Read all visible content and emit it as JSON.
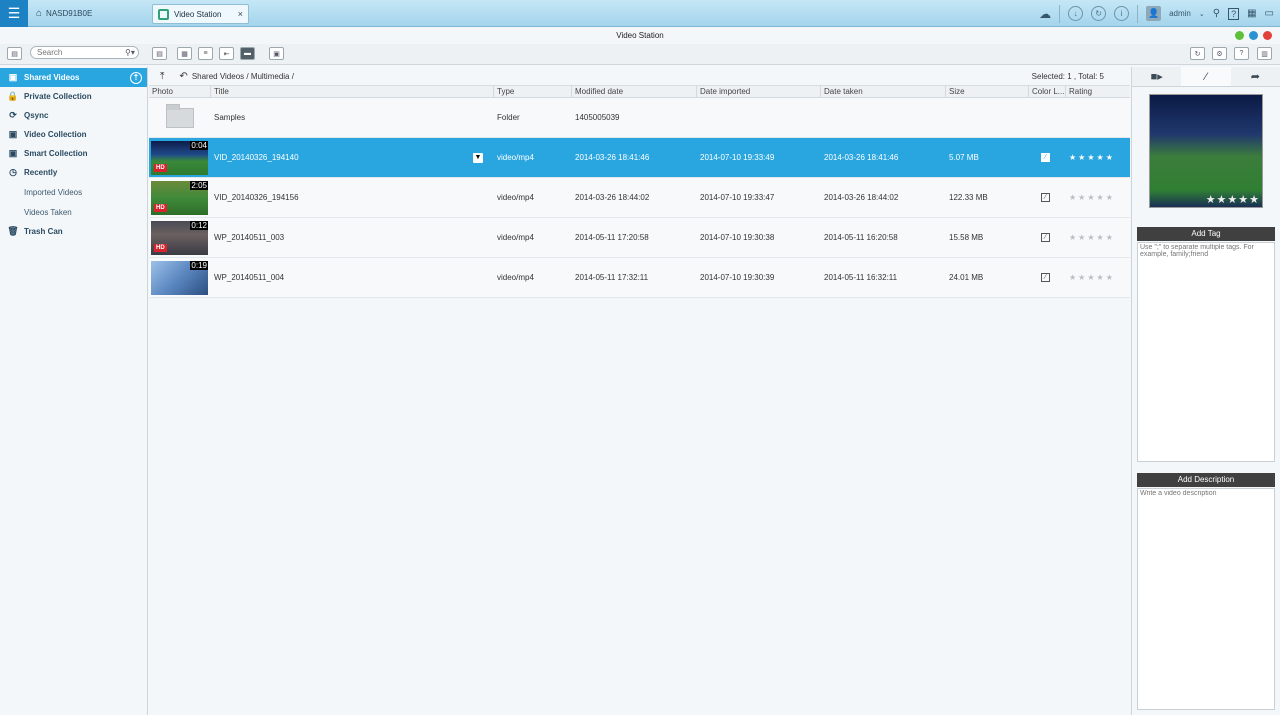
{
  "topbar": {
    "nas_name": "NASD91B0E",
    "tab_label": "Video Station",
    "tab_close": "×",
    "user": "admin"
  },
  "window": {
    "title": "Video Station"
  },
  "search": {
    "placeholder": "Search"
  },
  "sidebar": {
    "items": [
      {
        "label": "Shared Videos",
        "icon": "shared-videos-icon"
      },
      {
        "label": "Private Collection",
        "icon": "lock-icon"
      },
      {
        "label": "Qsync",
        "icon": "qsync-icon"
      },
      {
        "label": "Video Collection",
        "icon": "collection-icon"
      },
      {
        "label": "Smart Collection",
        "icon": "smart-collection-icon"
      },
      {
        "label": "Recently",
        "icon": "clock-icon"
      },
      {
        "label": "Imported Videos"
      },
      {
        "label": "Videos Taken"
      },
      {
        "label": "Trash Can",
        "icon": "trash-icon"
      }
    ]
  },
  "main": {
    "breadcrumb": "Shared Videos / Multimedia /",
    "count": "Selected: 1 , Total: 5",
    "columns": [
      "Photo",
      "Title",
      "Type",
      "Modified date",
      "Date imported",
      "Date taken",
      "Size",
      "Color L...",
      "Rating"
    ],
    "rows": [
      {
        "title": "Samples",
        "type": "Folder",
        "modified": "1405005039",
        "imported": "",
        "taken": "",
        "size": "",
        "duration": ""
      },
      {
        "title": "VID_20140326_194140",
        "type": "video/mp4",
        "modified": "2014-03-26 18:41:46",
        "imported": "2014-07-10 19:33:49",
        "taken": "2014-03-26 18:41:46",
        "size": "5.07 MB",
        "duration": "0:04",
        "hd": "HD"
      },
      {
        "title": "VID_20140326_194156",
        "type": "video/mp4",
        "modified": "2014-03-26 18:44:02",
        "imported": "2014-07-10 19:33:47",
        "taken": "2014-03-26 18:44:02",
        "size": "122.33 MB",
        "duration": "2:05",
        "hd": "HD"
      },
      {
        "title": "WP_20140511_003",
        "type": "video/mp4",
        "modified": "2014-05-11 17:20:58",
        "imported": "2014-07-10 19:30:38",
        "taken": "2014-05-11 16:20:58",
        "size": "15.58 MB",
        "duration": "0:12",
        "hd": "HD"
      },
      {
        "title": "WP_20140511_004",
        "type": "video/mp4",
        "modified": "2014-05-11 17:32:11",
        "imported": "2014-07-10 19:30:39",
        "taken": "2014-05-11 16:32:11",
        "size": "24.01 MB",
        "duration": "0:19",
        "hd": ""
      }
    ],
    "stars": "★★★★★"
  },
  "rpanel": {
    "tag_title": "Add Tag",
    "tag_hint": "Use \";\" to separate multiple tags. For example, family;friend",
    "desc_title": "Add Description",
    "desc_hint": "Write a video description"
  },
  "colors": {
    "accent": "#29a6e0",
    "topbar": "#a4d4ec"
  }
}
